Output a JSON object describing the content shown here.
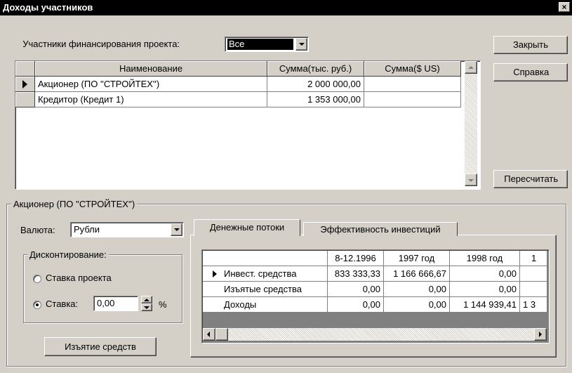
{
  "window": {
    "title": "Доходы участников",
    "close": "×"
  },
  "participants": {
    "label": "Участники финансирования проекта:",
    "selected": "Все"
  },
  "buttons": {
    "close": "Закрыть",
    "help": "Справка",
    "recalc": "Пересчитать",
    "withdraw": "Изъятие средств"
  },
  "table": {
    "headers": [
      "Наименование",
      "Сумма(тыс. руб.)",
      "Сумма($ US)"
    ],
    "rows": [
      {
        "name": "Акционер (ПО ''СТРОЙТЕХ'')",
        "rub": "2 000 000,00",
        "usd": ""
      },
      {
        "name": "Кредитор (Кредит 1)",
        "rub": "1 353 000,00",
        "usd": ""
      }
    ]
  },
  "detail": {
    "group_title": "Акционер (ПО ''СТРОЙТЕХ'')",
    "currency_label": "Валюта:",
    "currency_value": "Рубли",
    "discount": {
      "title": "Дисконтирование:",
      "opt_project": "Ставка проекта",
      "opt_rate": "Ставка:",
      "rate_value": "0,00",
      "percent": "%"
    },
    "tabs": [
      "Денежные потоки",
      "Эффективность инвестиций"
    ],
    "cashflow": {
      "columns": [
        "8-12.1996",
        "1997 год",
        "1998 год",
        "1"
      ],
      "rows": [
        {
          "label": "Инвест. средства",
          "values": [
            "833 333,33",
            "1 166 666,67",
            "0,00",
            ""
          ]
        },
        {
          "label": "Изъятые средства",
          "values": [
            "0,00",
            "0,00",
            "0,00",
            ""
          ]
        },
        {
          "label": "Доходы",
          "values": [
            "0,00",
            "0,00",
            "1 144 939,41",
            "1 3"
          ]
        }
      ]
    }
  }
}
